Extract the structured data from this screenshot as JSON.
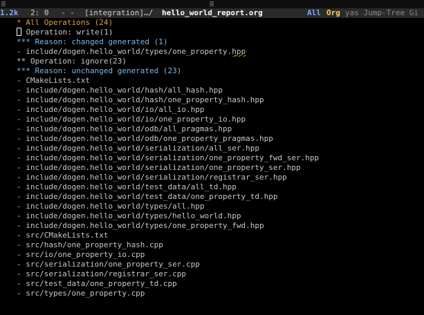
{
  "titlebar": {},
  "modeline": {
    "size": "1.2k",
    "position": "2: 0",
    "flags": "- -",
    "project": "[integration]…/",
    "filename": "hello_world_report.org",
    "all": "All",
    "major_mode": "Org",
    "minor_modes": "yas Jump-Tree Gi"
  },
  "document": {
    "heading_1": "* All Operations (24)",
    "op_write": {
      "stars": "* Operation: write(1)",
      "reason": "*** Reason: changed generated (1)",
      "items": [
        {
          "prefix": "- include/dogen.hello_world/types/one_property.",
          "ext": "hpp"
        }
      ]
    },
    "op_ignore": {
      "heading": "** Operation: ignore(23)",
      "reason": "*** Reason: unchanged generated (23)",
      "items": [
        "- CMakeLists.txt",
        "- include/dogen.hello_world/hash/all_hash.hpp",
        "- include/dogen.hello_world/hash/one_property_hash.hpp",
        "- include/dogen.hello_world/io/all_io.hpp",
        "- include/dogen.hello_world/io/one_property_io.hpp",
        "- include/dogen.hello_world/odb/all_pragmas.hpp",
        "- include/dogen.hello_world/odb/one_property_pragmas.hpp",
        "- include/dogen.hello_world/serialization/all_ser.hpp",
        "- include/dogen.hello_world/serialization/one_property_fwd_ser.hpp",
        "- include/dogen.hello_world/serialization/one_property_ser.hpp",
        "- include/dogen.hello_world/serialization/registrar_ser.hpp",
        "- include/dogen.hello_world/test_data/all_td.hpp",
        "- include/dogen.hello_world/test_data/one_property_td.hpp",
        "- include/dogen.hello_world/types/all.hpp",
        "- include/dogen.hello_world/types/hello_world.hpp",
        "- include/dogen.hello_world/types/one_property_fwd.hpp",
        "- src/CMakeLists.txt",
        "- src/hash/one_property_hash.cpp",
        "- src/io/one_property_io.cpp",
        "- src/serialization/one_property_ser.cpp",
        "- src/serialization/registrar_ser.cpp",
        "- src/test_data/one_property_td.cpp",
        "- src/types/one_property.cpp"
      ]
    }
  },
  "colors": {
    "background": "#000000",
    "heading1": "#e0a040",
    "heading3": "#7ab8e8",
    "modeline_bg": "#2a2a2a",
    "major_mode": "#ffd24a"
  }
}
